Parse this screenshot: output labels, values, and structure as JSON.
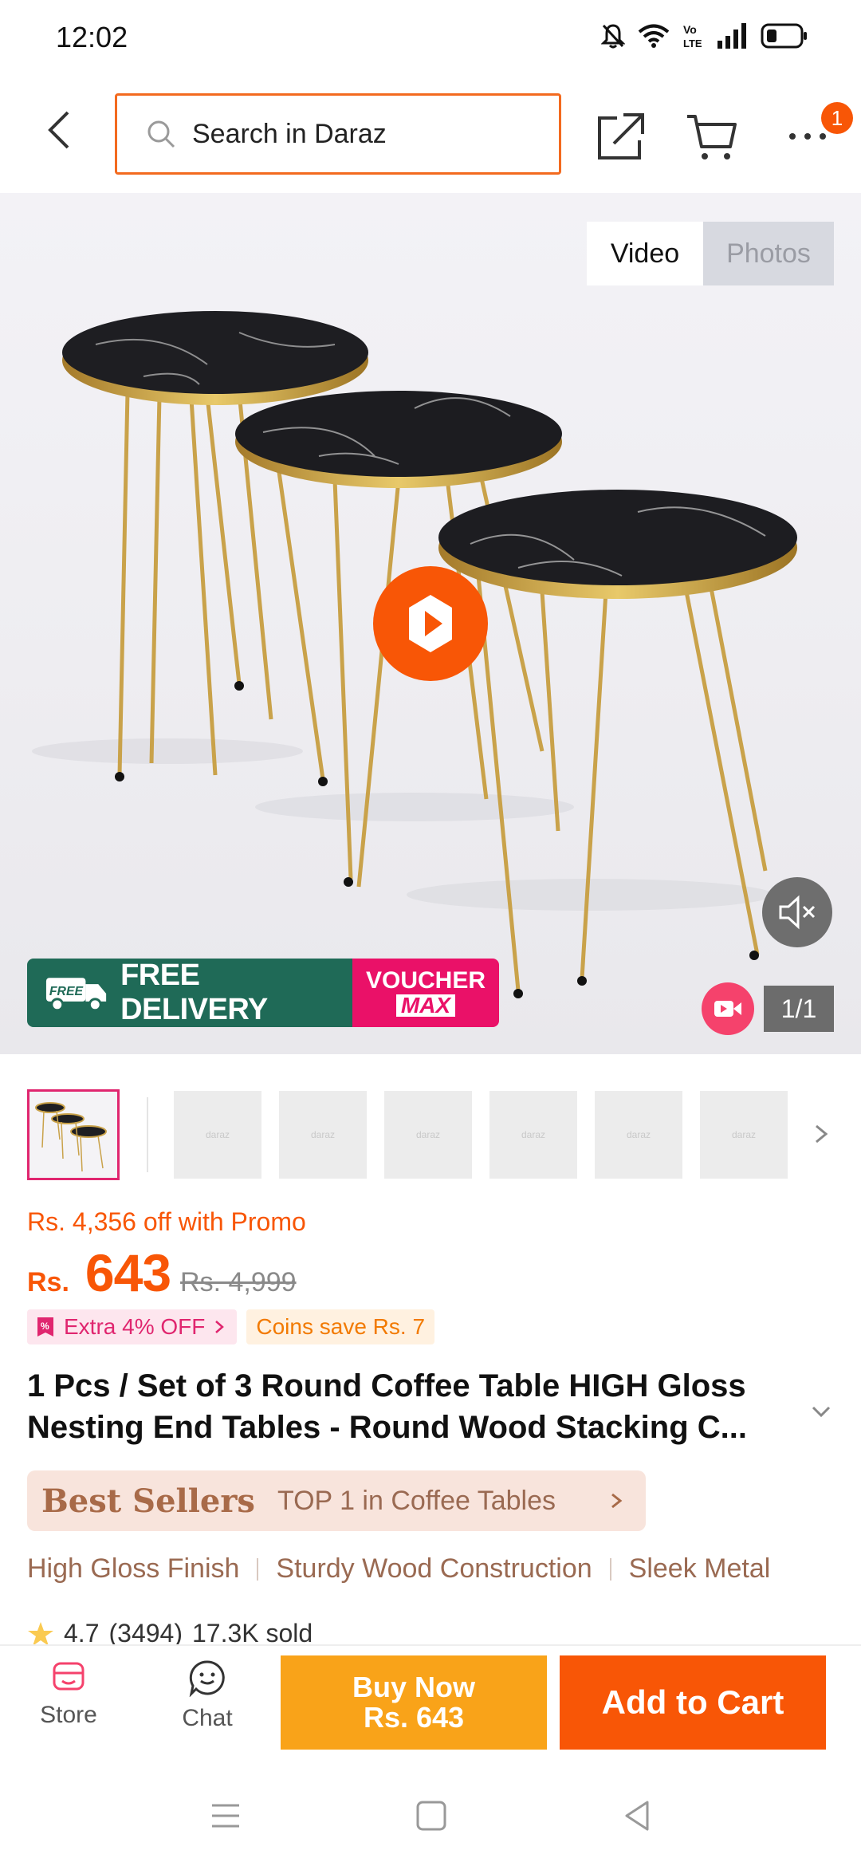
{
  "status_bar": {
    "time": "12:02",
    "icons": [
      "mute-bell-icon",
      "wifi-icon",
      "volte-icon",
      "signal-icon",
      "battery-icon"
    ]
  },
  "top_nav": {
    "search_placeholder": "Search in Daraz",
    "notification_count": "1",
    "icons": [
      "back-icon",
      "search-icon",
      "share-icon",
      "cart-icon",
      "more-icon"
    ]
  },
  "media": {
    "tab_video": "Video",
    "tab_photos": "Photos",
    "active_tab": "Video",
    "counter": "1/1",
    "delivery_label": "FREE DELIVERY",
    "delivery_truck_label": "FREE",
    "voucher_line1": "VOUCHER",
    "voucher_line2": "MAX"
  },
  "thumbnails": {
    "placeholder_label": "daraz",
    "count": 7
  },
  "price": {
    "promo_text": "Rs. 4,356 off with Promo",
    "currency": "Rs.",
    "current": "643",
    "original": "Rs. 4,999",
    "chip_extra": "Extra 4% OFF",
    "chip_coins": "Coins save Rs. 7"
  },
  "product": {
    "title_line1": "1 Pcs / Set of 3 Round Coffee Table HIGH Gloss",
    "title_line2": "Nesting End Tables - Round Wood Stacking C..."
  },
  "best_seller": {
    "brand": "Best Sellers",
    "text": "TOP 1 in Coffee Tables"
  },
  "features": [
    "High Gloss Finish",
    "Sturdy Wood Construction",
    "Sleek Metal"
  ],
  "rating": {
    "score": "4.7",
    "count": "(3494)",
    "sold": "17.3K sold"
  },
  "action_bar": {
    "store_label": "Store",
    "chat_label": "Chat",
    "buy_now_line1": "Buy Now",
    "buy_now_line2": "Rs. 643",
    "add_to_cart": "Add to Cart"
  },
  "colors": {
    "accent_orange": "#f85606",
    "buy_now_yellow": "#f9a319",
    "delivery_green": "#1f6a57",
    "voucher_pink": "#ea1168",
    "best_seller_bg": "#f8e4dc"
  }
}
